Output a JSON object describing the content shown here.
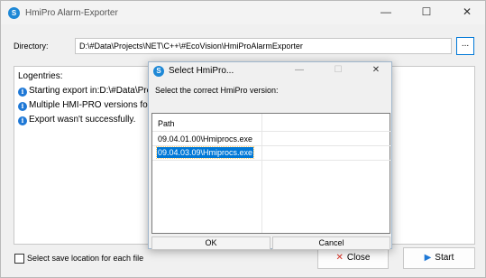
{
  "main_window": {
    "title": "HmiPro Alarm-Exporter",
    "app_icon_glyph": "S",
    "controls": {
      "minimize": "—",
      "maximize": "☐",
      "close": "✕"
    }
  },
  "directory": {
    "label": "Directory:",
    "value": "D:\\#Data\\Projects\\NET\\C++\\#EcoVision\\HmiProAlarmExporter",
    "browse_label": "..."
  },
  "log": {
    "header": "Logentries:",
    "entries": [
      {
        "icon": "info-icon",
        "text": "Starting export in:D:\\#Data\\Pro"
      },
      {
        "icon": "info-icon",
        "text": "Multiple HMI-PRO versions fou"
      },
      {
        "icon": "info-icon",
        "text": "Export wasn't successfully."
      }
    ]
  },
  "options": {
    "save_location_label": "Select save location for each file",
    "save_location_checked": false
  },
  "buttons": {
    "close_label": "Close",
    "close_icon": "close-icon",
    "start_label": "Start",
    "start_icon": "play-icon"
  },
  "dialog": {
    "title": "Select HmiPro...",
    "app_icon_glyph": "S",
    "controls": {
      "minimize": "—",
      "maximize": "☐",
      "close": "✕"
    },
    "instruction": "Select the correct HmiPro version:",
    "list": {
      "header": "Path",
      "rows": [
        {
          "path": "09.04.01.00\\Hmiprocs.exe",
          "selected": false
        },
        {
          "path": "09.04.03.09\\Hmiprocs.exe",
          "selected": true
        }
      ]
    },
    "ok_label": "OK",
    "cancel_label": "Cancel"
  },
  "colors": {
    "accent": "#0078d7",
    "app_icon": "#1e88d6",
    "close_icon": "#d93025",
    "start_icon": "#1e78d6"
  }
}
